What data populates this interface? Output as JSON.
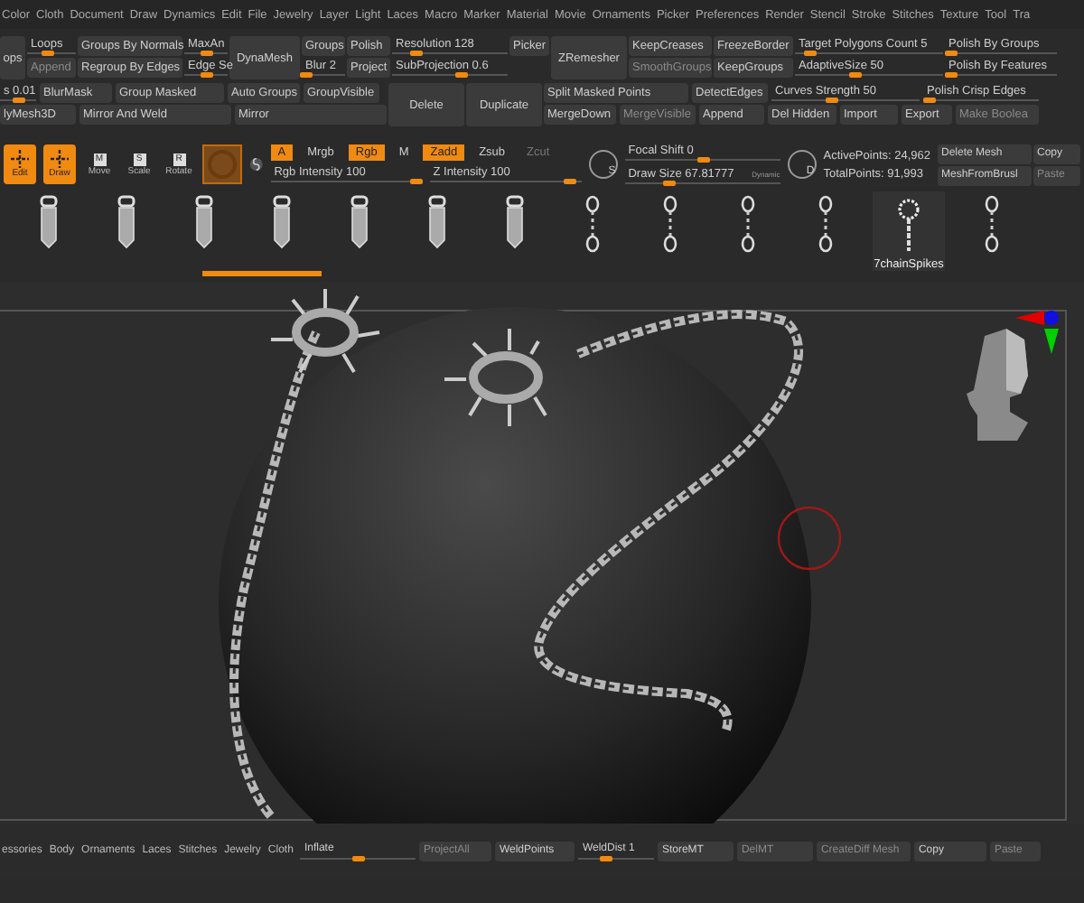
{
  "menu": [
    "Color",
    "Cloth",
    "Document",
    "Draw",
    "Dynamics",
    "Edit",
    "File",
    "Jewelry",
    "Layer",
    "Light",
    "Laces",
    "Macro",
    "Marker",
    "Material",
    "Movie",
    "Ornaments",
    "Picker",
    "Preferences",
    "Render",
    "Stencil",
    "Stroke",
    "Stitches",
    "Texture",
    "Tool",
    "Tra"
  ],
  "top_columns": [
    [
      {
        "label": "ops",
        "kind": "big"
      }
    ],
    [
      {
        "label": "Loops",
        "kind": "slider",
        "level": 0.4
      },
      {
        "label": "Append",
        "kind": "disabled"
      }
    ],
    [
      {
        "label": "Groups By Normals",
        "kind": "button"
      },
      {
        "label": "Regroup By Edges",
        "kind": "button"
      }
    ],
    [
      {
        "label": "MaxAn",
        "kind": "slider",
        "level": 0.5
      },
      {
        "label": "Edge Se",
        "kind": "slider",
        "level": 0.5
      }
    ],
    [
      {
        "label": "DynaMesh",
        "kind": "big"
      }
    ],
    [
      {
        "label": "Groups",
        "kind": "button"
      },
      {
        "label": "Blur 2",
        "kind": "slider",
        "level": 0.1
      }
    ],
    [
      {
        "label": "Polish",
        "kind": "button"
      },
      {
        "label": "Project",
        "kind": "button"
      }
    ],
    [
      {
        "label": "Resolution 128",
        "kind": "slider",
        "level": 0.2
      },
      {
        "label": "SubProjection 0.6",
        "kind": "slider",
        "level": 0.6
      }
    ],
    [
      {
        "label": "Picker",
        "kind": "button"
      }
    ],
    [
      {
        "label": "ZRemesher",
        "kind": "big"
      }
    ],
    [
      {
        "label": "KeepCreases",
        "kind": "button"
      },
      {
        "label": "SmoothGroups",
        "kind": "disabled"
      }
    ],
    [
      {
        "label": "FreezeBorder",
        "kind": "button"
      },
      {
        "label": "KeepGroups",
        "kind": "button"
      }
    ],
    [
      {
        "label": "Target Polygons Count 5",
        "kind": "slider",
        "level": 0.1
      },
      {
        "label": "AdaptiveSize 50",
        "kind": "slider",
        "level": 0.4
      }
    ],
    [
      {
        "label": "Polish By Groups",
        "kind": "slider",
        "level": 0.05
      },
      {
        "label": "Polish By Features",
        "kind": "slider",
        "level": 0.05
      }
    ]
  ],
  "left_rows": [
    [
      {
        "label": "s 0.01",
        "kind": "slider",
        "level": 0.5
      },
      {
        "label": "BlurMask",
        "kind": "button"
      },
      {
        "label": "Group Masked",
        "kind": "button"
      },
      {
        "label": "Auto Groups",
        "kind": "button"
      },
      {
        "label": "GroupVisible",
        "kind": "button"
      }
    ],
    [
      {
        "label": "lyMesh3D",
        "kind": "button"
      },
      {
        "label": "Mirror And Weld",
        "kind": "button"
      },
      {
        "label": "Mirror",
        "kind": "button"
      }
    ]
  ],
  "big_buttons": [
    "Delete",
    "Duplicate"
  ],
  "right_rows": [
    [
      {
        "label": "Split Masked Points",
        "kind": "button"
      },
      {
        "label": "DetectEdges",
        "kind": "button"
      },
      {
        "label": "Curves Strength 50",
        "kind": "slider",
        "level": 0.4
      },
      {
        "label": "Polish Crisp Edges",
        "kind": "slider",
        "level": 0.05
      }
    ],
    [
      {
        "label": "MergeDown",
        "kind": "button"
      },
      {
        "label": "MergeVisible",
        "kind": "disabled"
      },
      {
        "label": "Append",
        "kind": "button"
      },
      {
        "label": "Del Hidden",
        "kind": "button"
      },
      {
        "label": "Import",
        "kind": "button"
      },
      {
        "label": "Export",
        "kind": "button"
      },
      {
        "label": "Make Boolea",
        "kind": "disabled"
      }
    ]
  ],
  "modes": [
    {
      "label": "Edit",
      "selected": true
    },
    {
      "label": "Draw",
      "selected": true
    },
    {
      "label": "Move",
      "glyph": "M",
      "selected": false
    },
    {
      "label": "Scale",
      "glyph": "S",
      "selected": false
    },
    {
      "label": "Rotate",
      "glyph": "R",
      "selected": false
    }
  ],
  "channels": [
    {
      "label": "A",
      "selected": true,
      "disabled": false
    },
    {
      "label": "Mrgb",
      "selected": false,
      "disabled": false
    },
    {
      "label": "Rgb",
      "selected": true,
      "disabled": false
    },
    {
      "label": "M",
      "selected": false,
      "disabled": false
    },
    {
      "label": "Zadd",
      "selected": true,
      "disabled": false
    },
    {
      "label": "Zsub",
      "selected": false,
      "disabled": false
    },
    {
      "label": "Zcut",
      "selected": false,
      "disabled": true
    }
  ],
  "intensities": [
    {
      "label": "Rgb Intensity 100",
      "level": 0.95
    },
    {
      "label": "Z Intensity 100",
      "level": 0.92
    }
  ],
  "focal": {
    "icon_letter": "S",
    "sliders": [
      {
        "label": "Focal Shift 0",
        "level": 0.5
      },
      {
        "label": "Draw Size 67.81777",
        "level": 0.28
      }
    ],
    "dynamic": "Dynamic"
  },
  "stats": {
    "icon_letter": "D",
    "lines": [
      "ActivePoints: 24,962",
      "TotalPoints: 91,993"
    ]
  },
  "mesh_buttons": [
    {
      "label": "Delete Mesh",
      "disabled": false
    },
    {
      "label": "Copy",
      "disabled": false
    },
    {
      "label": "MeshFromBrusl",
      "disabled": false
    },
    {
      "label": "Paste",
      "disabled": true
    }
  ],
  "tools": [
    {
      "selected": false
    },
    {
      "selected": false
    },
    {
      "selected": false
    },
    {
      "selected": false
    },
    {
      "selected": false
    },
    {
      "selected": false
    },
    {
      "selected": false
    },
    {
      "selected": false
    },
    {
      "selected": false
    },
    {
      "selected": false
    },
    {
      "selected": false
    },
    {
      "label": "7chainSpikes",
      "selected": true
    },
    {
      "selected": false
    }
  ],
  "bottom_tabs": [
    "essories",
    "Body",
    "Ornaments",
    "Laces",
    "Stitches",
    "Jewelry",
    "Cloth"
  ],
  "bottom_controls": [
    {
      "label": "Inflate",
      "kind": "slider",
      "level": 0.5
    },
    {
      "label": "ProjectAll",
      "kind": "disabled"
    },
    {
      "label": "WeldPoints",
      "kind": "button"
    },
    {
      "label": "WeldDist 1",
      "kind": "slider",
      "level": 0.35
    },
    {
      "label": "StoreMT",
      "kind": "button"
    },
    {
      "label": "DelMT",
      "kind": "disabled"
    },
    {
      "label": "CreateDiff Mesh",
      "kind": "disabled"
    },
    {
      "label": "Copy",
      "kind": "button"
    },
    {
      "label": "Paste",
      "kind": "disabled"
    }
  ]
}
